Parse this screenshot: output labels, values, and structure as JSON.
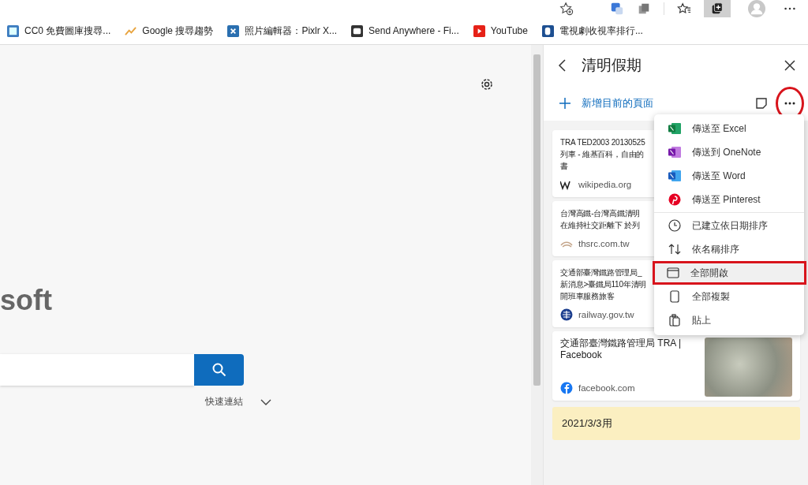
{
  "bookmarks": [
    {
      "label": "CC0 免費圖庫搜尋..."
    },
    {
      "label": "Google 搜尋趨勢"
    },
    {
      "label": "照片編輯器：Pixlr X..."
    },
    {
      "label": "Send Anywhere - Fi..."
    },
    {
      "label": "YouTube"
    },
    {
      "label": "電視劇收視率排行..."
    }
  ],
  "page": {
    "logo_text": "soft",
    "quick_links": "快速連結"
  },
  "panel": {
    "title": "清明假期",
    "add_label": "新增目前的頁面",
    "more_circled": true,
    "cards": [
      {
        "title_lines": [
          "TRA TED2003 20130525",
          "列車 - 維基百科，自由的",
          "書"
        ],
        "site": "wikipedia.org"
      },
      {
        "title_lines": [
          "台灣高鐵-台灣高鐵清明",
          "在維持社交距離下 於列"
        ],
        "site": "thsrc.com.tw"
      },
      {
        "title_lines": [
          "交通部臺灣鐵路管理局_",
          "新消息>臺鐵局110年清明",
          "開班車服務旅客"
        ],
        "site": "railway.gov.tw"
      },
      {
        "title_lines": [
          "交通部臺灣鐵路管理局 TRA |",
          "Facebook"
        ],
        "site": "facebook.com",
        "has_image": true
      }
    ],
    "note": "2021/3/3用",
    "menu": [
      {
        "label": "傳送至 Excel",
        "highlighted": false
      },
      {
        "label": "傳送到 OneNote",
        "highlighted": false
      },
      {
        "label": "傳送至 Word",
        "highlighted": false
      },
      {
        "label": "傳送至 Pinterest",
        "highlighted": false
      },
      {
        "label": "已建立依日期排序",
        "highlighted": false
      },
      {
        "label": "依名稱排序",
        "highlighted": false
      },
      {
        "label": "全部開啟",
        "highlighted": true
      },
      {
        "label": "全部複製",
        "highlighted": false
      },
      {
        "label": "貼上",
        "highlighted": false
      }
    ]
  }
}
